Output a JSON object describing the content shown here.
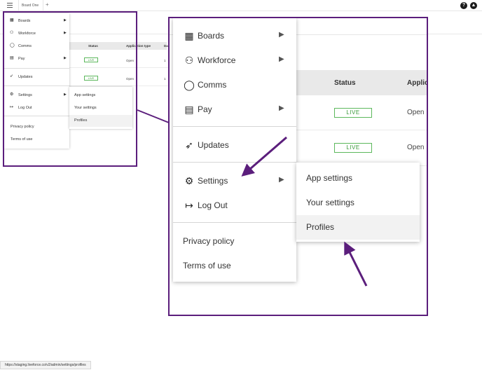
{
  "topbar": {
    "tab_label": "Board One",
    "add_tab": "+",
    "help_icon": "question-icon",
    "help_glyph": "?",
    "user_icon": "user-icon",
    "user_glyph": "▲"
  },
  "table": {
    "columns": [
      "Status",
      "Application type",
      "Da"
    ],
    "zoom_columns": [
      "Status",
      "Applic"
    ],
    "rows": [
      {
        "status": "LIVE",
        "type": "Open",
        "date": "1"
      },
      {
        "status": "LIVE",
        "type": "Open",
        "date": "1"
      }
    ]
  },
  "menu": {
    "items": [
      {
        "label": "Boards",
        "icon": "grid-icon",
        "glyph": "▦",
        "has_submenu": true
      },
      {
        "label": "Workforce",
        "icon": "people-icon",
        "glyph": "⚇",
        "has_submenu": true
      },
      {
        "label": "Comms",
        "icon": "chat-bubble-icon",
        "glyph": "◯",
        "has_submenu": false
      },
      {
        "label": "Pay",
        "icon": "money-icon",
        "glyph": "▤",
        "has_submenu": true
      },
      {
        "label": "Updates",
        "icon": "rocket-icon",
        "glyph": "➶",
        "has_submenu": false
      },
      {
        "label": "Settings",
        "icon": "gear-icon",
        "glyph": "⚙",
        "has_submenu": true
      },
      {
        "label": "Log Out",
        "icon": "logout-icon",
        "glyph": "↦",
        "has_submenu": false
      },
      {
        "label": "Privacy policy",
        "has_submenu": false
      },
      {
        "label": "Terms of use",
        "has_submenu": false
      }
    ],
    "chevron": "▶"
  },
  "submenu": {
    "items": [
      {
        "label": "App settings"
      },
      {
        "label": "Your settings"
      },
      {
        "label": "Profiles",
        "active": true
      }
    ]
  },
  "status_url": "https://staging.liveforce.co/v2/admin/settings/profiles",
  "colors": {
    "highlight": "#5b1e7c",
    "live_border": "#5cb85c",
    "live_text": "#3a9a3a"
  }
}
